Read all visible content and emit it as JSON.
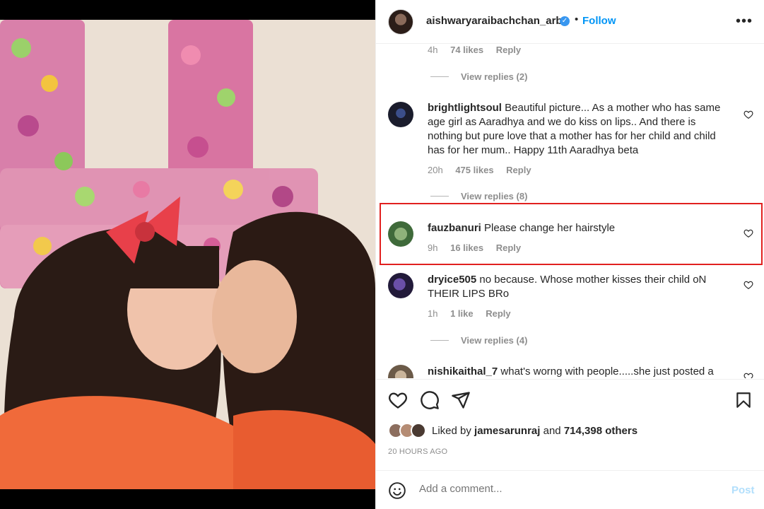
{
  "post": {
    "username": "aishwaryaraibachchan_arb",
    "follow_label": "Follow",
    "dot": "•"
  },
  "comments_area": {
    "top_meta": {
      "time": "4h",
      "likes": "74 likes",
      "reply": "Reply"
    },
    "view_replies_1": "View replies (2)",
    "comments": [
      {
        "user": "brightlightsoul",
        "text": "Beautiful picture... As a mother who has same age girl as Aaradhya and we do kiss on lips.. And there is nothing but pure love that a mother has for her child and child has for her mum.. Happy 11th Aaradhya beta",
        "time": "20h",
        "likes": "475 likes",
        "reply": "Reply",
        "view_replies": "View replies (8)"
      },
      {
        "user": "fauzbanuri",
        "text": "Please change her hairstyle",
        "time": "9h",
        "likes": "16 likes",
        "reply": "Reply"
      },
      {
        "user": "dryice505",
        "text": "no because. Whose mother kisses their child oN THEIR LIPS BRo",
        "time": "1h",
        "likes": "1 like",
        "reply": "Reply",
        "view_replies": "View replies (4)"
      },
      {
        "user": "nishikaithal_7",
        "text": "what's worng with people.....she just posted a"
      }
    ]
  },
  "likes": {
    "prefix": "Liked by",
    "user": "jamesarunraj",
    "and": "and",
    "others": "714,398 others"
  },
  "timestamp": "20 HOURS AGO",
  "add_comment": {
    "placeholder": "Add a comment...",
    "post_label": "Post"
  },
  "colors": {
    "accent": "#0095f6",
    "highlight": "#e1201f",
    "verified": "#3897f0"
  }
}
